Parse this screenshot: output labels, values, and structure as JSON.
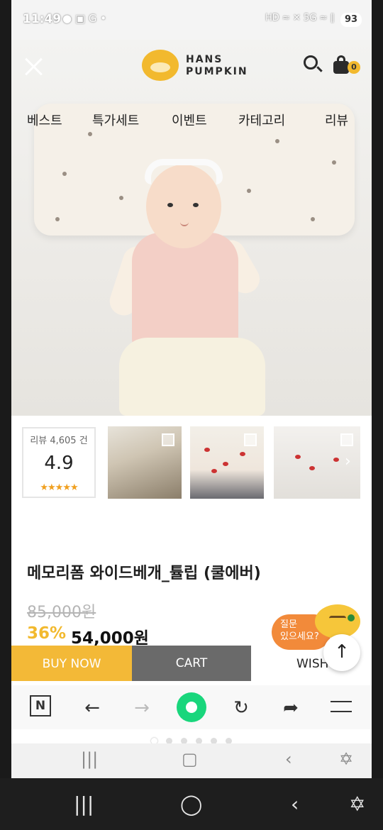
{
  "status_bar": {
    "time": "11:49",
    "left_icons": "● ▣ G •",
    "right_icons": "HD ≈ ✕ 5G ≈ ∥",
    "battery": "93"
  },
  "header": {
    "brand_line1": "HANS",
    "brand_line2": "PUMPKIN",
    "cart_count": "0"
  },
  "nav": {
    "items": [
      "베스트",
      "특가세트",
      "이벤트",
      "카테고리",
      "리뷰"
    ]
  },
  "review": {
    "count_label": "리뷰 4,605 건",
    "score": "4.9",
    "stars": "★★★★★"
  },
  "product": {
    "title": "메모리폼 와이드베개_튤립 (쿨에버)",
    "original_price": "85,000원",
    "discount": "36%",
    "sale_price": "54,000원"
  },
  "qna": {
    "line1": "질문",
    "line2": "있으세요?"
  },
  "actions": {
    "buy_now": "BUY NOW",
    "cart": "CART",
    "wish": "WISH"
  },
  "browser": {
    "n_label": "N"
  },
  "colors": {
    "accent": "#f3b937",
    "cart_button": "#6a6a6a",
    "green": "#19d67c",
    "qna": "#f28a3a"
  }
}
